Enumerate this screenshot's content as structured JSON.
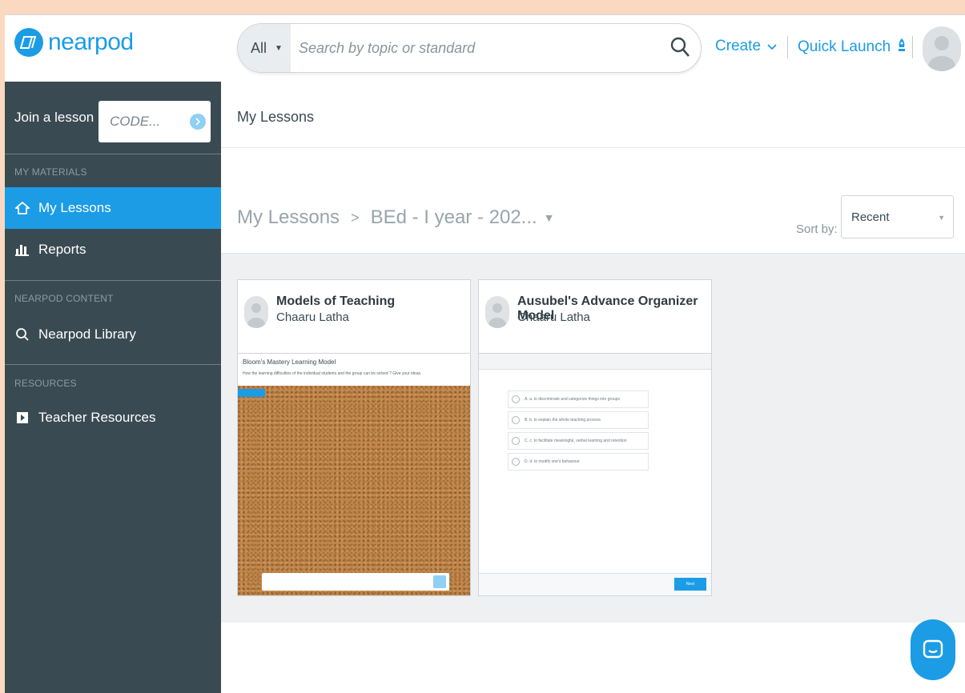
{
  "brand": {
    "name": "nearpod",
    "accent": "#1b9ce5",
    "sidebar_bg": "#3a4a53",
    "frame_bg": "#fbd9c0"
  },
  "header": {
    "search": {
      "scope": "All",
      "placeholder": "Search by topic or standard"
    },
    "create_label": "Create",
    "quick_launch_label": "Quick Launch"
  },
  "sidebar": {
    "join_label": "Join a lesson",
    "code_placeholder": "CODE...",
    "sections": [
      {
        "heading": "MY MATERIALS",
        "items": [
          {
            "label": "My Lessons",
            "icon": "home-icon",
            "active": true
          },
          {
            "label": "Reports",
            "icon": "bar-chart-icon",
            "active": false
          }
        ]
      },
      {
        "heading": "NEARPOD CONTENT",
        "items": [
          {
            "label": "Nearpod Library",
            "icon": "search-icon",
            "active": false
          }
        ]
      },
      {
        "heading": "RESOURCES",
        "items": [
          {
            "label": "Teacher Resources",
            "icon": "play-icon",
            "active": false
          }
        ]
      }
    ]
  },
  "main": {
    "title": "My Lessons",
    "breadcrumb": {
      "root": "My Lessons",
      "separator": ">",
      "folder": "BEd - I year - 202..."
    },
    "sort": {
      "label": "Sort by:",
      "selected": "Recent"
    },
    "lessons": [
      {
        "title": "Models of Teaching",
        "author": "Chaaru Latha",
        "thumb": {
          "question_title": "Bloom's Mastery Learning Model",
          "question_text": "How the learning difficulties of the individual students and the group can be solved ? Give your ideas."
        }
      },
      {
        "title": "Ausubel's Advance Organizer Model",
        "author": "Chaaru Latha",
        "thumb": {
          "options": [
            "A. a. to discriminate and categorize things into groups",
            "B. b. to explain the whole teaching process",
            "C. c. to facilitate meaningful, verbal learning and retention",
            "D. d. to modify one's behaviour"
          ],
          "next_label": "Next"
        }
      }
    ]
  }
}
